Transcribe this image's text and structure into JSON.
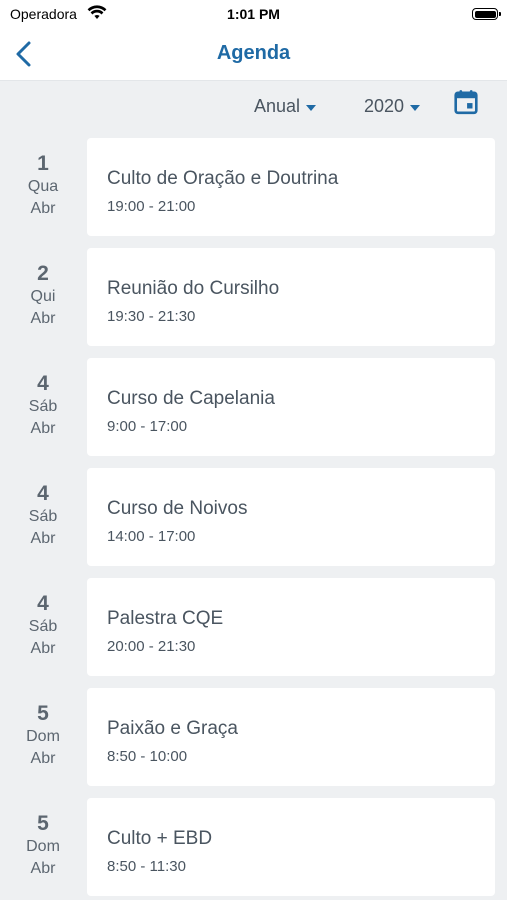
{
  "status_bar": {
    "carrier": "Operadora",
    "time": "1:01 PM"
  },
  "nav": {
    "title": "Agenda",
    "back_icon": "chevron-left-icon",
    "accent_color": "#1f6aa5"
  },
  "filters": {
    "period": "Anual",
    "year": "2020",
    "calendar_icon": "calendar-icon"
  },
  "events": [
    {
      "day": "1",
      "weekday": "Qua",
      "month": "Abr",
      "title": "Culto de Oração e Doutrina",
      "time": "19:00 - 21:00"
    },
    {
      "day": "2",
      "weekday": "Qui",
      "month": "Abr",
      "title": "Reunião do Cursilho",
      "time": "19:30 - 21:30"
    },
    {
      "day": "4",
      "weekday": "Sáb",
      "month": "Abr",
      "title": "Curso de Capelania",
      "time": "9:00 - 17:00"
    },
    {
      "day": "4",
      "weekday": "Sáb",
      "month": "Abr",
      "title": "Curso de Noivos",
      "time": "14:00 - 17:00"
    },
    {
      "day": "4",
      "weekday": "Sáb",
      "month": "Abr",
      "title": "Palestra CQE",
      "time": "20:00 - 21:30"
    },
    {
      "day": "5",
      "weekday": "Dom",
      "month": "Abr",
      "title": "Paixão e Graça",
      "time": "8:50 - 10:00"
    },
    {
      "day": "5",
      "weekday": "Dom",
      "month": "Abr",
      "title": "Culto + EBD",
      "time": "8:50 - 11:30"
    }
  ]
}
